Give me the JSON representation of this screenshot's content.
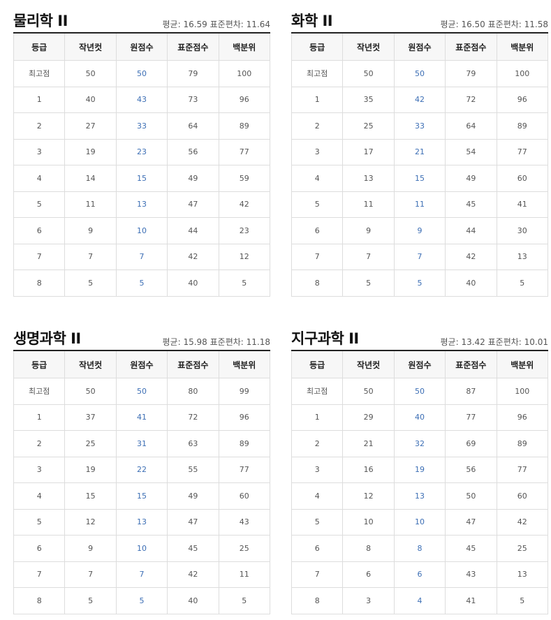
{
  "columns": [
    "등급",
    "작년컷",
    "원점수",
    "표준점수",
    "백분위"
  ],
  "panels": [
    {
      "title": "물리학 II",
      "stats": "평균: 16.59 표준편차: 11.64",
      "rows": [
        [
          "최고점",
          "50",
          "50",
          "79",
          "100"
        ],
        [
          "1",
          "40",
          "43",
          "73",
          "96"
        ],
        [
          "2",
          "27",
          "33",
          "64",
          "89"
        ],
        [
          "3",
          "19",
          "23",
          "56",
          "77"
        ],
        [
          "4",
          "14",
          "15",
          "49",
          "59"
        ],
        [
          "5",
          "11",
          "13",
          "47",
          "42"
        ],
        [
          "6",
          "9",
          "10",
          "44",
          "23"
        ],
        [
          "7",
          "7",
          "7",
          "42",
          "12"
        ],
        [
          "8",
          "5",
          "5",
          "40",
          "5"
        ]
      ]
    },
    {
      "title": "화학 II",
      "stats": "평균: 16.50 표준편차: 11.58",
      "rows": [
        [
          "최고점",
          "50",
          "50",
          "79",
          "100"
        ],
        [
          "1",
          "35",
          "42",
          "72",
          "96"
        ],
        [
          "2",
          "25",
          "33",
          "64",
          "89"
        ],
        [
          "3",
          "17",
          "21",
          "54",
          "77"
        ],
        [
          "4",
          "13",
          "15",
          "49",
          "60"
        ],
        [
          "5",
          "11",
          "11",
          "45",
          "41"
        ],
        [
          "6",
          "9",
          "9",
          "44",
          "30"
        ],
        [
          "7",
          "7",
          "7",
          "42",
          "13"
        ],
        [
          "8",
          "5",
          "5",
          "40",
          "5"
        ]
      ]
    },
    {
      "title": "생명과학 II",
      "stats": "평균: 15.98 표준편차: 11.18",
      "rows": [
        [
          "최고점",
          "50",
          "50",
          "80",
          "99"
        ],
        [
          "1",
          "37",
          "41",
          "72",
          "96"
        ],
        [
          "2",
          "25",
          "31",
          "63",
          "89"
        ],
        [
          "3",
          "19",
          "22",
          "55",
          "77"
        ],
        [
          "4",
          "15",
          "15",
          "49",
          "60"
        ],
        [
          "5",
          "12",
          "13",
          "47",
          "43"
        ],
        [
          "6",
          "9",
          "10",
          "45",
          "25"
        ],
        [
          "7",
          "7",
          "7",
          "42",
          "11"
        ],
        [
          "8",
          "5",
          "5",
          "40",
          "5"
        ]
      ]
    },
    {
      "title": "지구과학 II",
      "stats": "평균: 13.42 표준편차: 10.01",
      "rows": [
        [
          "최고점",
          "50",
          "50",
          "87",
          "100"
        ],
        [
          "1",
          "29",
          "40",
          "77",
          "96"
        ],
        [
          "2",
          "21",
          "32",
          "69",
          "89"
        ],
        [
          "3",
          "16",
          "19",
          "56",
          "77"
        ],
        [
          "4",
          "12",
          "13",
          "50",
          "60"
        ],
        [
          "5",
          "10",
          "10",
          "47",
          "42"
        ],
        [
          "6",
          "8",
          "8",
          "45",
          "25"
        ],
        [
          "7",
          "6",
          "6",
          "43",
          "13"
        ],
        [
          "8",
          "3",
          "4",
          "41",
          "5"
        ]
      ]
    }
  ],
  "colors": {
    "raw_score": "#3d6fb5",
    "border": "#dddddd",
    "header_bg": "#f7f7f7"
  }
}
